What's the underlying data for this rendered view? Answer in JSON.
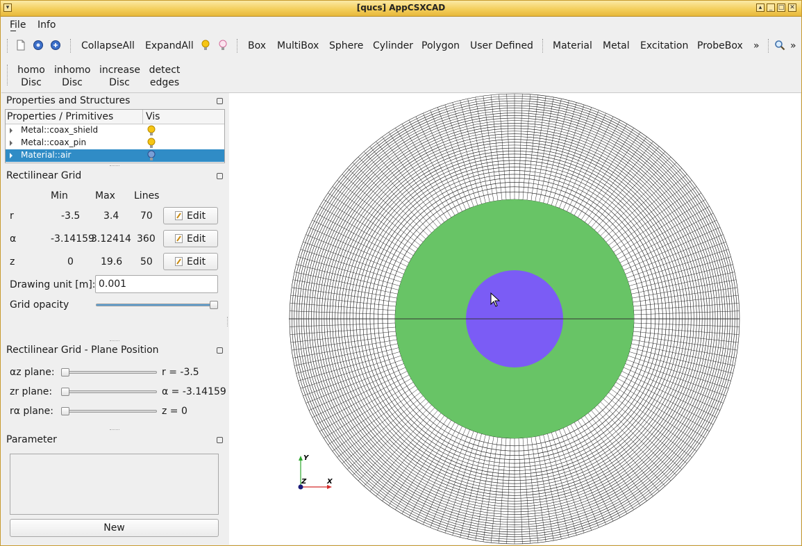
{
  "window": {
    "title": "[qucs] AppCSXCAD"
  },
  "menu": {
    "file": "File",
    "info": "Info"
  },
  "toolbar": {
    "collapse_all": "CollapseAll",
    "expand_all": "ExpandAll",
    "box": "Box",
    "multibox": "MultiBox",
    "sphere": "Sphere",
    "cylinder": "Cylinder",
    "polygon": "Polygon",
    "user_defined": "User Defined",
    "material": "Material",
    "metal": "Metal",
    "excitation": "Excitation",
    "probebox": "ProbeBox",
    "more": "»"
  },
  "toolbar2": {
    "homo": {
      "l1": "homo",
      "l2": "Disc"
    },
    "inhomo": {
      "l1": "inhomo",
      "l2": "Disc"
    },
    "increase": {
      "l1": "increase",
      "l2": "Disc"
    },
    "detect": {
      "l1": "detect",
      "l2": "edges"
    }
  },
  "props": {
    "title": "Properties and Structures",
    "col_name": "Properties / Primitives",
    "col_vis": "Vis",
    "items": [
      {
        "label": "Metal::coax_shield"
      },
      {
        "label": "Metal::coax_pin"
      },
      {
        "label": "Material::air"
      }
    ]
  },
  "grid": {
    "title": "Rectilinear Grid",
    "col_min": "Min",
    "col_max": "Max",
    "col_lines": "Lines",
    "rows": [
      {
        "axis": "r",
        "min": "-3.5",
        "max": "3.4",
        "lines": "70",
        "edit": "Edit"
      },
      {
        "axis": "α",
        "min": "-3.14159",
        "max": "3.12414",
        "lines": "360",
        "edit": "Edit"
      },
      {
        "axis": "z",
        "min": "0",
        "max": "19.6",
        "lines": "50",
        "edit": "Edit"
      }
    ],
    "drawing_unit_label": "Drawing unit [m]:",
    "drawing_unit_value": "0.001",
    "opacity_label": "Grid opacity",
    "opacity_value": 1.0
  },
  "plane": {
    "title": "Rectilinear Grid - Plane Position",
    "rows": [
      {
        "label": "αz plane:",
        "value": "r = -3.5",
        "pos": 0
      },
      {
        "label": "zr plane:",
        "value": "α = -3.14159",
        "pos": 0
      },
      {
        "label": "rα plane:",
        "value": "z = 0",
        "pos": 0
      }
    ]
  },
  "parameter": {
    "title": "Parameter",
    "new_label": "New"
  },
  "view": {
    "axis_y": "Y",
    "axis_z": "Z",
    "axis_x": "X",
    "colors": {
      "air": "#68c466",
      "pin": "#7b5cf5",
      "mesh": "#111111"
    }
  }
}
